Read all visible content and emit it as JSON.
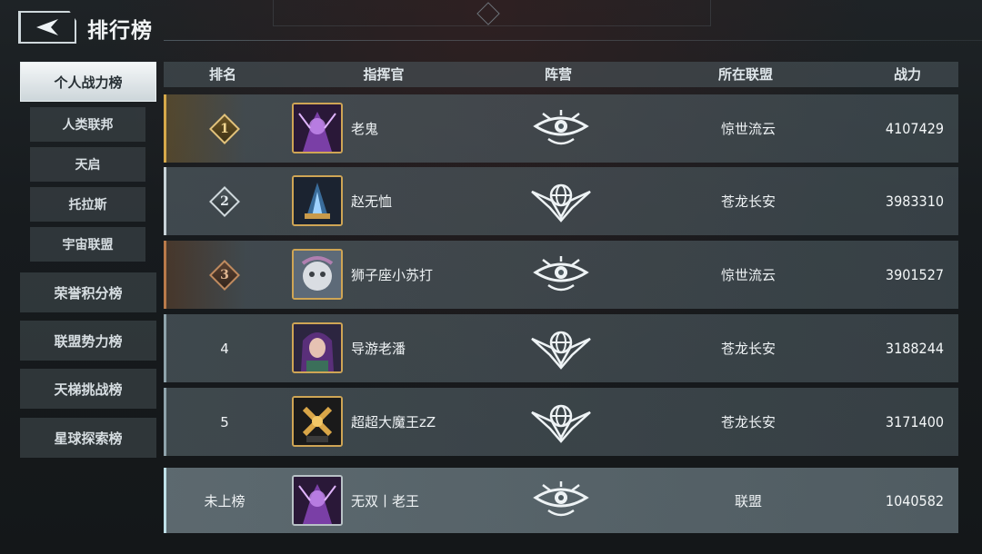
{
  "header": {
    "title": "排行榜",
    "back_icon": "back-arrow-icon"
  },
  "sidebar": {
    "main_items": [
      {
        "label": "个人战力榜",
        "active": true
      },
      {
        "label": "荣誉积分榜",
        "active": false
      },
      {
        "label": "联盟势力榜",
        "active": false
      },
      {
        "label": "天梯挑战榜",
        "active": false
      },
      {
        "label": "星球探索榜",
        "active": false
      }
    ],
    "sub_items": [
      {
        "label": "人类联邦"
      },
      {
        "label": "天启"
      },
      {
        "label": "托拉斯"
      },
      {
        "label": "宇宙联盟"
      }
    ]
  },
  "table": {
    "columns": [
      "排名",
      "指挥官",
      "阵营",
      "所在联盟",
      "战力"
    ],
    "rows": [
      {
        "rank": "1",
        "name": "老鬼",
        "faction_icon": "eye-emblem-icon",
        "alliance": "惊世流云",
        "power": "4107429"
      },
      {
        "rank": "2",
        "name": "赵无恤",
        "faction_icon": "winged-globe-emblem-icon",
        "alliance": "苍龙长安",
        "power": "3983310"
      },
      {
        "rank": "3",
        "name": "狮子座小苏打",
        "faction_icon": "eye-emblem-icon",
        "alliance": "惊世流云",
        "power": "3901527"
      },
      {
        "rank": "4",
        "name": "导游老潘",
        "faction_icon": "winged-globe-emblem-icon",
        "alliance": "苍龙长安",
        "power": "3188244"
      },
      {
        "rank": "5",
        "name": "超超大魔王zZ",
        "faction_icon": "winged-globe-emblem-icon",
        "alliance": "苍龙长安",
        "power": "3171400"
      }
    ],
    "my_row": {
      "rank": "未上榜",
      "name": "无双丨老王",
      "faction_icon": "eye-emblem-icon",
      "alliance": "联盟",
      "power": "1040582"
    }
  },
  "colors": {
    "gold": "#d6a94a",
    "silver": "#c8d3d8",
    "bronze": "#b87a4a",
    "accent": "#cfa555"
  }
}
